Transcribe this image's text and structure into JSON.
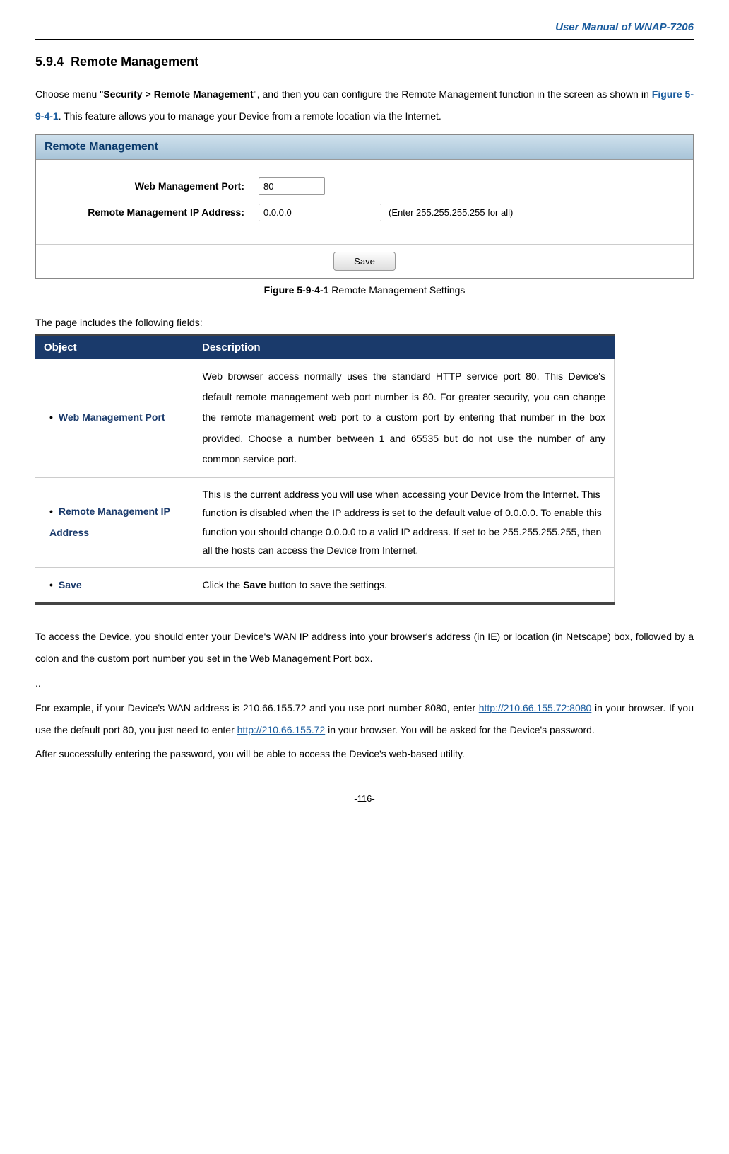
{
  "header": {
    "doc_title": "User Manual of WNAP-7206"
  },
  "section": {
    "number": "5.9.4",
    "title": "Remote Management"
  },
  "intro": {
    "part1": "Choose menu \"",
    "breadcrumb": "Security > Remote Management",
    "part2": "\", and then you can configure the Remote Management function in the screen as shown in ",
    "figure_ref": "Figure 5-9-4-1",
    "part3": ". This feature allows you to manage your Device from a remote location via the Internet."
  },
  "screenshot": {
    "panel_title": "Remote Management",
    "rows": [
      {
        "label": "Web Management Port:",
        "value": "80",
        "hint": ""
      },
      {
        "label": "Remote Management IP Address:",
        "value": "0.0.0.0",
        "hint": "(Enter 255.255.255.255 for all)"
      }
    ],
    "save_button": "Save"
  },
  "figure_caption": {
    "bold": "Figure 5-9-4-1",
    "text": " Remote Management Settings"
  },
  "fields_intro": "The page includes the following fields:",
  "table": {
    "headers": {
      "object": "Object",
      "description": "Description"
    },
    "rows": [
      {
        "object": "Web Management Port",
        "description": "Web browser access normally uses the standard HTTP service port 80. This Device's default remote management web port number is 80. For greater security, you can change the remote management web port to a custom port by entering that number in the box provided. Choose a number between 1 and 65535 but do not use the number of any common service port."
      },
      {
        "object": "Remote Management IP Address",
        "description": "This is the current address you will use when accessing your Device from the Internet. This function is disabled when the IP address is set to the default value of 0.0.0.0. To enable this function you should change 0.0.0.0 to a valid IP address. If set to be 255.255.255.255, then all the hosts can access the Device from Internet."
      },
      {
        "object": "Save",
        "description_pre": "Click the ",
        "description_bold": "Save",
        "description_post": " button to save the settings."
      }
    ]
  },
  "body": {
    "p1": "To access the Device, you should enter your Device's WAN IP address into your browser's address (in IE) or location (in Netscape) box, followed by a colon and the custom port number you set in the Web Management Port box.",
    "dots": "..",
    "p2_a": "For example, if your Device's WAN address is 210.66.155.72 and you use port number 8080, enter ",
    "url1": "http://210.66.155.72:8080",
    "p2_b": " in your browser. If you use the default port 80, you just need to enter ",
    "url2": "http://210.66.155.72",
    "p2_c": " in your browser. You will be asked for the Device's password.",
    "p3": "After successfully entering the password, you will be able to access the Device's web-based utility."
  },
  "page_number": "-116-"
}
